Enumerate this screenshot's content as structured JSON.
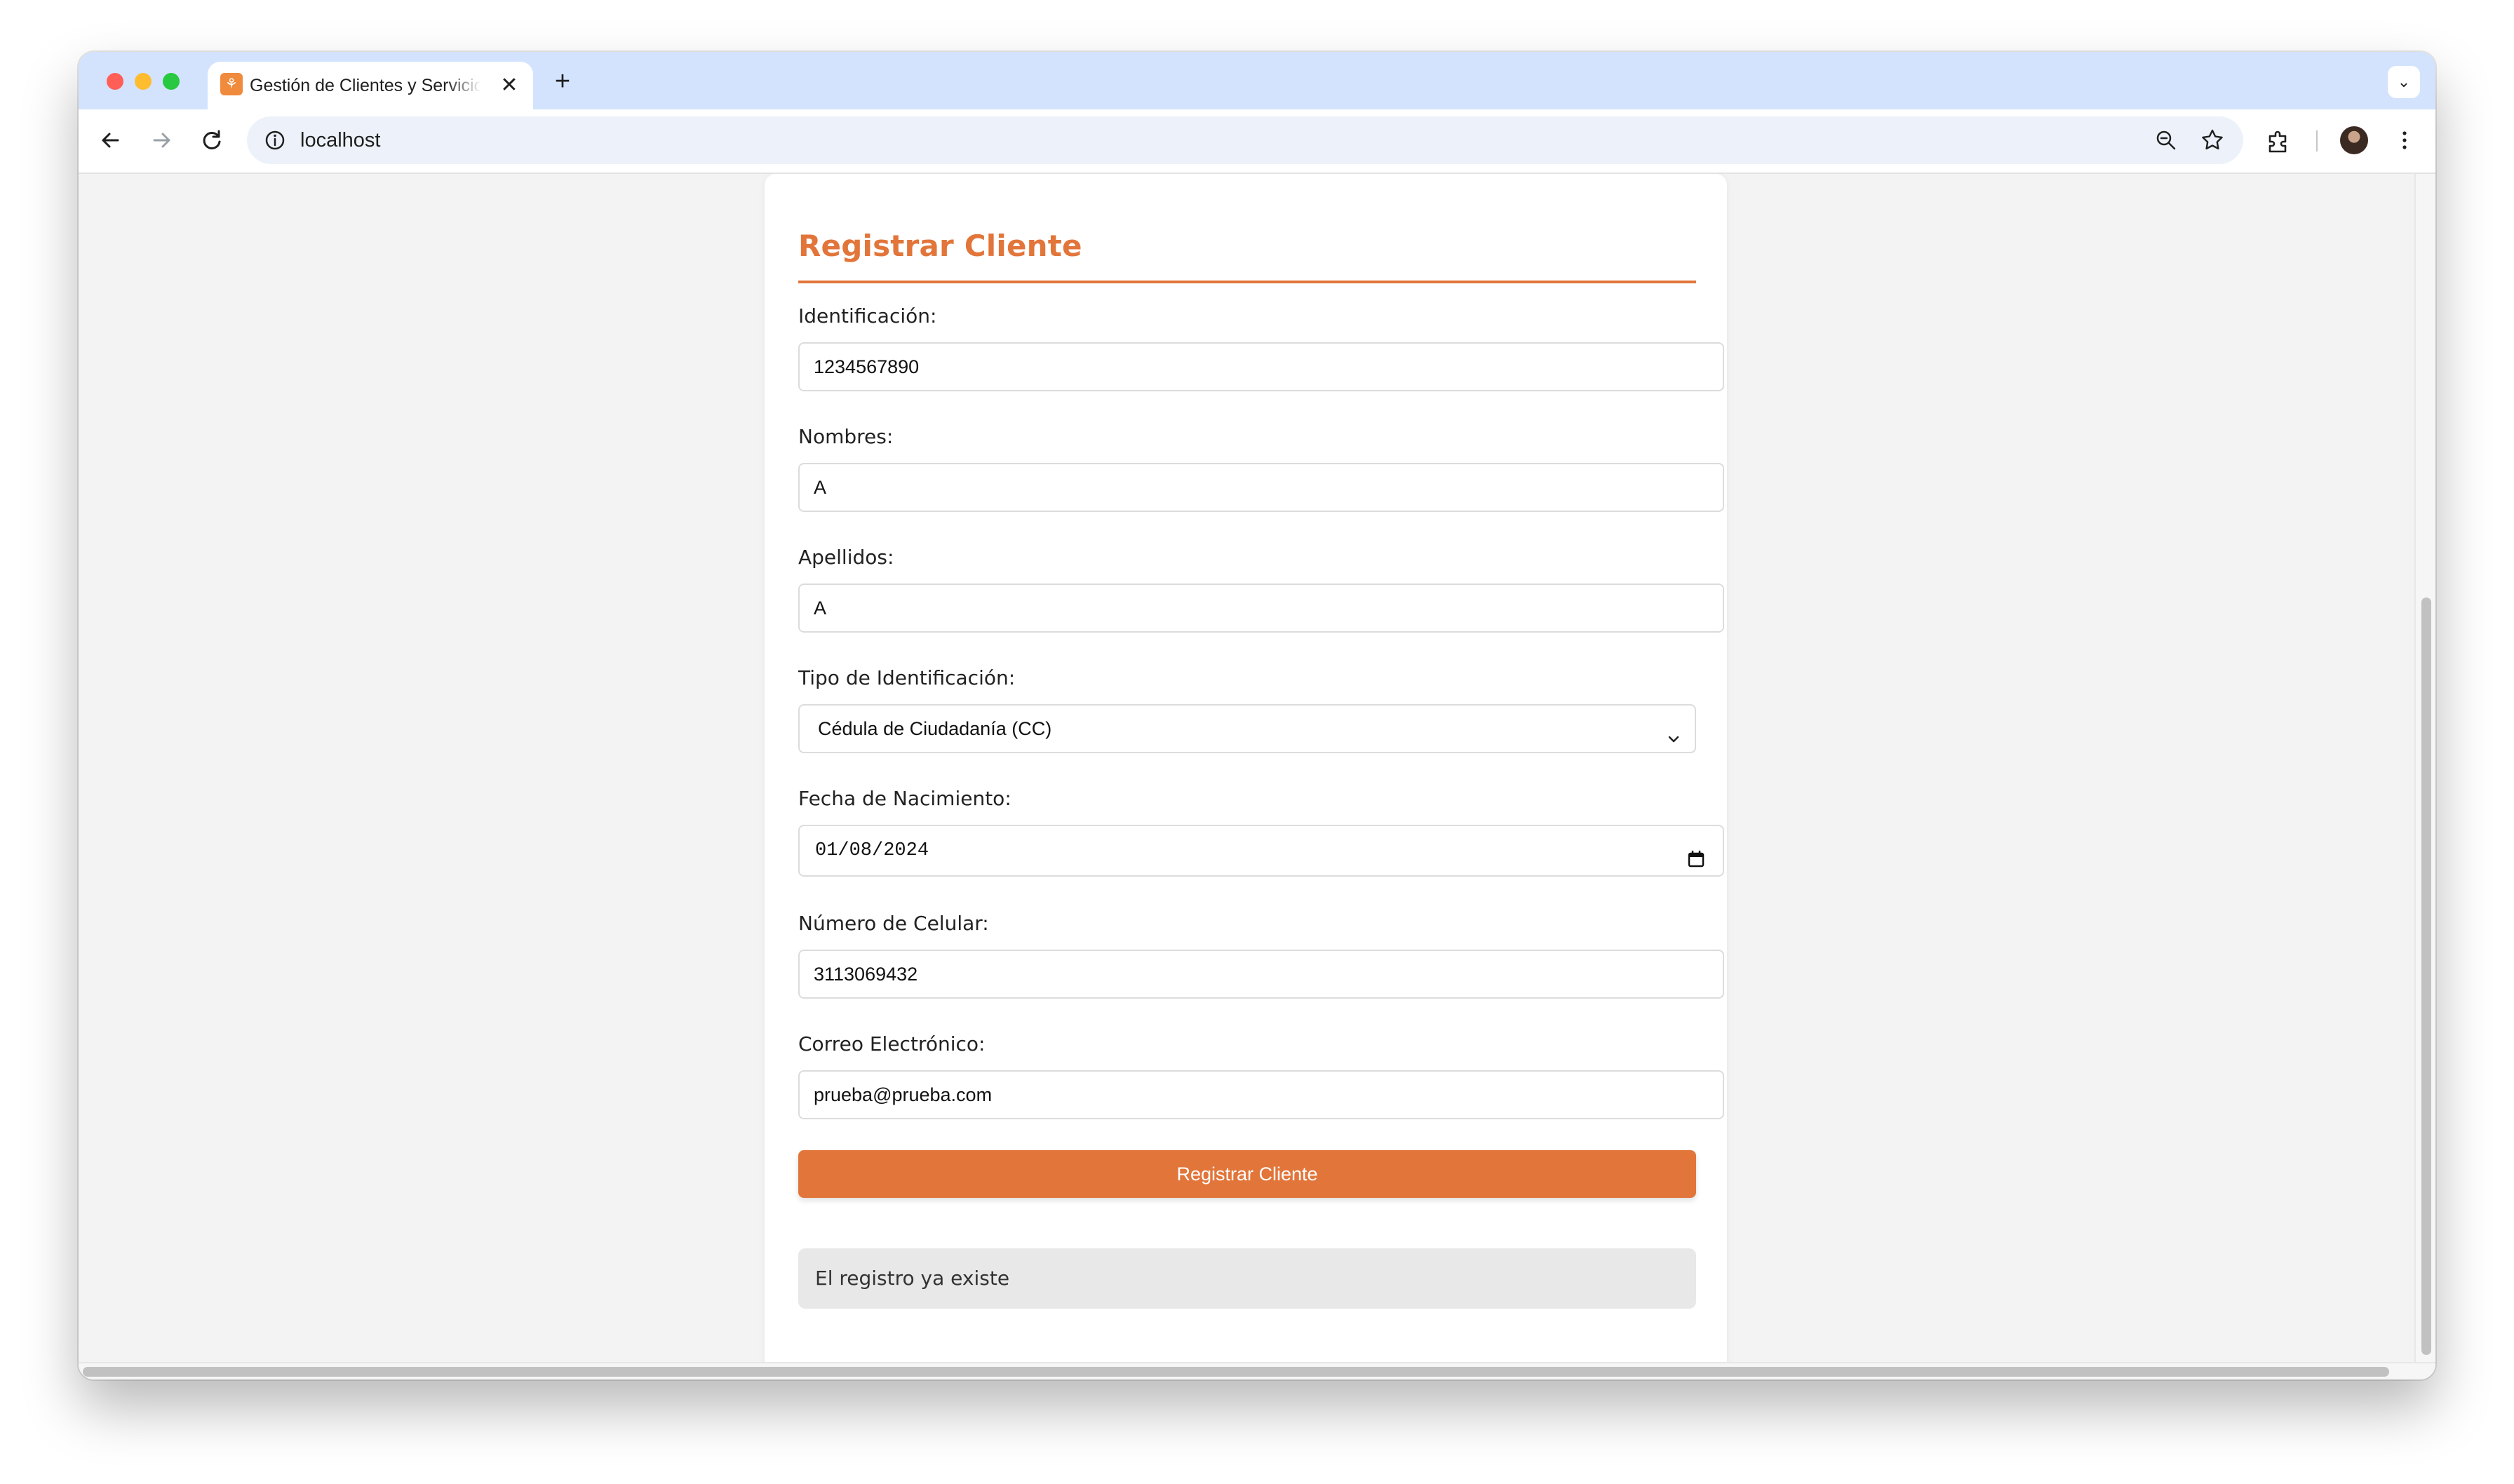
{
  "browser": {
    "tab_title": "Gestión de Clientes y Servicios",
    "tab_favicon": "leaf-logo-icon",
    "url": "localhost",
    "icons": [
      "back-arrow-icon",
      "forward-arrow-icon",
      "reload-icon",
      "site-info-icon",
      "zoom-icon",
      "bookmark-star-icon",
      "extensions-icon",
      "profile-avatar",
      "kebab-menu-icon",
      "tab-search-chevron-icon"
    ]
  },
  "form": {
    "title": "Registrar Cliente",
    "accent_color": "#e2753a",
    "fields": {
      "identificacion": {
        "label": "Identificación:",
        "value": "1234567890"
      },
      "nombres": {
        "label": "Nombres:",
        "value": "A"
      },
      "apellidos": {
        "label": "Apellidos:",
        "value": "A"
      },
      "tipo_identificacion": {
        "label": "Tipo de Identificación:",
        "selected": "Cédula de Ciudadanía (CC)"
      },
      "fecha_nacimiento": {
        "label": "Fecha de Nacimiento:",
        "value": "01/08/2024"
      },
      "celular": {
        "label": "Número de Celular:",
        "value": "3113069432"
      },
      "correo": {
        "label": "Correo Electrónico:",
        "value": "prueba@prueba.com"
      }
    },
    "submit_label": "Registrar Cliente",
    "message": "El registro ya existe"
  }
}
